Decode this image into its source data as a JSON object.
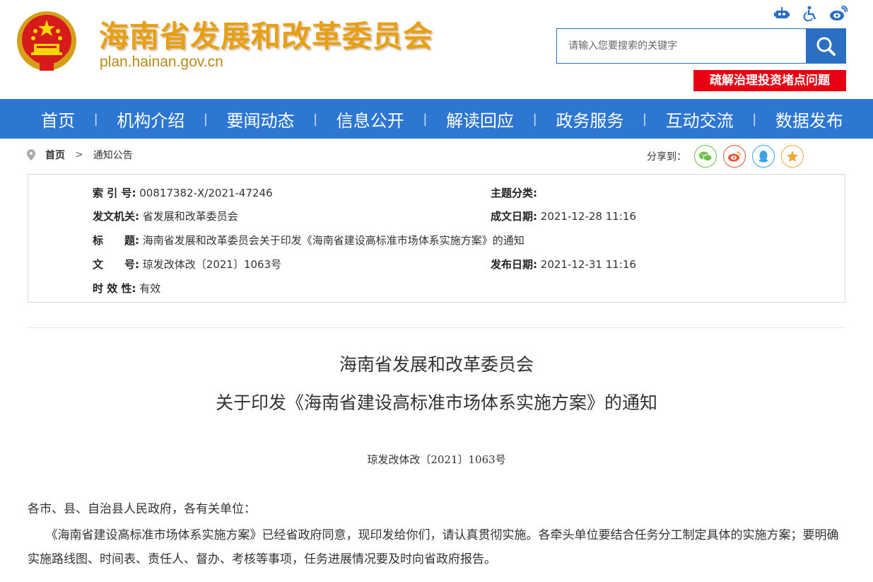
{
  "header": {
    "site_title": "海南省发展和改革委员会",
    "site_domain": "plan.hainan.gov.cn",
    "search_placeholder": "请输入您要搜索的关键字",
    "promo_banner": "疏解治理投资堵点问题"
  },
  "nav": {
    "items": [
      "首页",
      "机构介绍",
      "要闻动态",
      "信息公开",
      "解读回应",
      "政务服务",
      "互动交流",
      "数据发布"
    ]
  },
  "breadcrumb": {
    "home": "首页",
    "current": "通知公告"
  },
  "share": {
    "label": "分享到："
  },
  "info": {
    "index_label": "索 引 号:",
    "index_value": "00817382-X/2021-47246",
    "topic_label": "主题分类:",
    "topic_value": "",
    "issuer_label": "发文机关:",
    "issuer_value": "省发展和改革委员会",
    "created_label": "成文日期:",
    "created_value": "2021-12-28 11:16",
    "title_label": "标　　题:",
    "title_value": "海南省发展和改革委员会关于印发《海南省建设高标准市场体系实施方案》的通知",
    "docno_label": "文　　号:",
    "docno_value": "琼发改体改〔2021〕1063号",
    "published_label": "发布日期:",
    "published_value": "2021-12-31 11:16",
    "validity_label": "时 效 性:",
    "validity_value": "有效"
  },
  "article": {
    "title_line1": "海南省发展和改革委员会",
    "title_line2": "关于印发《海南省建设高标准市场体系实施方案》的通知",
    "doc_number": "琼发改体改〔2021〕1063号",
    "salutation": "各市、县、自治县人民政府，各有关单位：",
    "body": "　　《海南省建设高标准市场体系实施方案》已经省政府同意，现印发给你们，请认真贯彻实施。各牵头单位要结合任务分工制定具体的实施方案；要明确实施路线图、时间表、责任人、督办、考核等事项，任务进展情况要及时向省政府报告。"
  },
  "colors": {
    "nav_blue": "#2d77d2",
    "title_gold": "#e8a013",
    "banner_red": "#e60012"
  }
}
